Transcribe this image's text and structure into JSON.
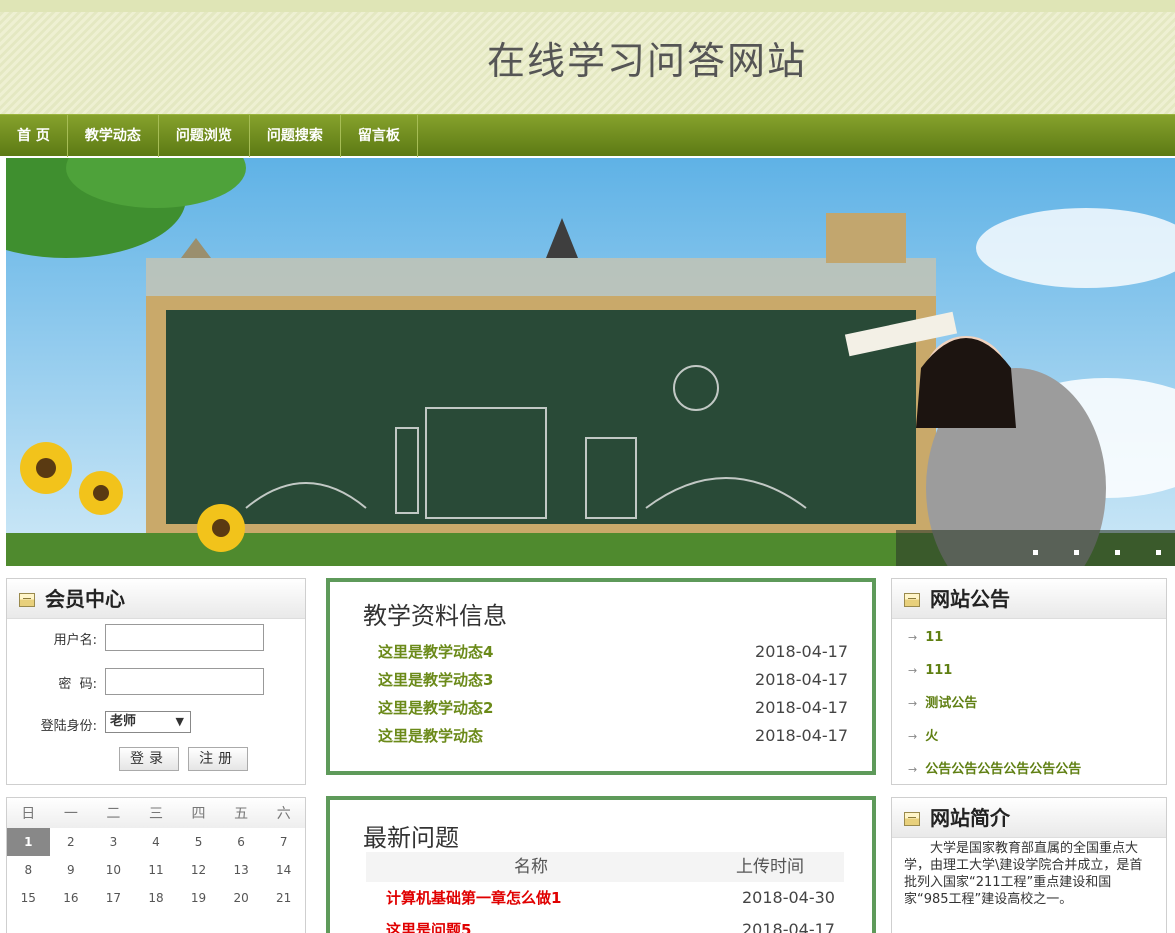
{
  "header": {
    "title": "在线学习问答网站"
  },
  "nav": {
    "items": [
      "首 页",
      "教学动态",
      "问题浏览",
      "问题搜索",
      "留言板"
    ]
  },
  "member_center": {
    "title": "会员中心",
    "username_label": "用户名:",
    "password_label": "密  码:",
    "role_label": "登陆身份:",
    "role_value": "老师",
    "login_button": "登录",
    "register_button": "注册"
  },
  "calendar": {
    "weekdays": [
      "日",
      "一",
      "二",
      "三",
      "四",
      "五",
      "六"
    ],
    "weeks": [
      [
        "1",
        "2",
        "3",
        "4",
        "5",
        "6",
        "7"
      ],
      [
        "8",
        "9",
        "10",
        "11",
        "12",
        "13",
        "14"
      ],
      [
        "15",
        "16",
        "17",
        "18",
        "19",
        "20",
        "21"
      ]
    ],
    "today": "1"
  },
  "teaching_info": {
    "title": "教学资料信息",
    "items": [
      {
        "title": "这里是教学动态4",
        "date": "2018-04-17"
      },
      {
        "title": "这里是教学动态3",
        "date": "2018-04-17"
      },
      {
        "title": "这里是教学动态2",
        "date": "2018-04-17"
      },
      {
        "title": "这里是教学动态",
        "date": "2018-04-17"
      }
    ]
  },
  "latest_questions": {
    "title": "最新问题",
    "col_name": "名称",
    "col_time": "上传时间",
    "items": [
      {
        "title": "计算机基础第一章怎么做1",
        "date": "2018-04-30"
      },
      {
        "title": "这里是问题5",
        "date": "2018-04-17"
      }
    ]
  },
  "announcements": {
    "title": "网站公告",
    "items": [
      "11",
      "111",
      "测试公告",
      "火",
      "公告公告公告公告公告公告"
    ]
  },
  "site_intro": {
    "title": "网站简介",
    "text": "大学是国家教育部直属的全国重点大学，由理工大学\\建设学院合并成立，是首批列入国家“211工程”重点建设和国家“985工程”建设高校之一。"
  },
  "icons": {
    "panel_header": "notepad-icon",
    "list_bullet": "arrow-bullet-icon"
  },
  "colors": {
    "nav_green": "#6f8c1e",
    "link_green": "#6b8a19",
    "question_red": "#e00000",
    "panel_border": "#5e9a5a"
  }
}
